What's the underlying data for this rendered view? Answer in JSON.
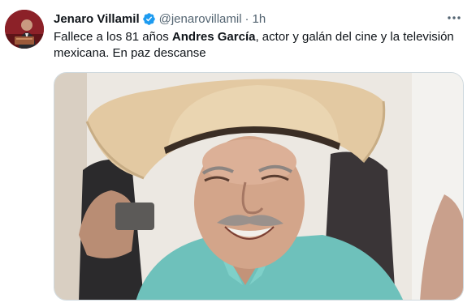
{
  "author": {
    "name": "Jenaro Villamil",
    "handle": "@jenarovillamil",
    "separator": "·",
    "time": "1h"
  },
  "tweet": {
    "text_before": "Fallece a los 81 años ",
    "text_bold": "Andres García",
    "text_after": ", actor y galán del cine y la televisión mexicana. En paz descanse"
  },
  "icons": {
    "verified": "verified-badge-icon",
    "more": "more-dots-icon"
  },
  "colors": {
    "verified_blue": "#1d9bf0",
    "secondary_text": "#536471",
    "primary_text": "#0f1419"
  }
}
